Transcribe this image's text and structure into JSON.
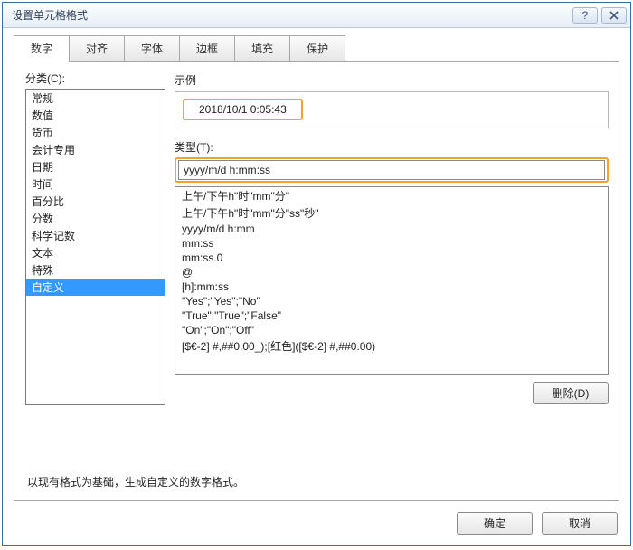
{
  "window": {
    "title": "设置单元格格式"
  },
  "tabs": {
    "items": [
      "数字",
      "对齐",
      "字体",
      "边框",
      "填充",
      "保护"
    ],
    "active": 0
  },
  "category": {
    "label": "分类(C):",
    "items": [
      "常规",
      "数值",
      "货币",
      "会计专用",
      "日期",
      "时间",
      "百分比",
      "分数",
      "科学记数",
      "文本",
      "特殊",
      "自定义"
    ],
    "selected": 11
  },
  "sample": {
    "label": "示例",
    "value": "2018/10/1 0:05:43"
  },
  "type": {
    "label": "类型(T):",
    "value": "yyyy/m/d h:mm:ss"
  },
  "formats": [
    "上午/下午h\"时\"mm\"分\"",
    "上午/下午h\"时\"mm\"分\"ss\"秒\"",
    "yyyy/m/d h:mm",
    "mm:ss",
    "mm:ss.0",
    "@",
    "[h]:mm:ss",
    "\"Yes\";\"Yes\";\"No\"",
    "\"True\";\"True\";\"False\"",
    "\"On\";\"On\";\"Off\"",
    "[$€-2] #,##0.00_);[红色]([$€-2] #,##0.00)"
  ],
  "buttons": {
    "delete": "删除(D)",
    "ok": "确定",
    "cancel": "取消"
  },
  "hint": "以现有格式为基础，生成自定义的数字格式。"
}
